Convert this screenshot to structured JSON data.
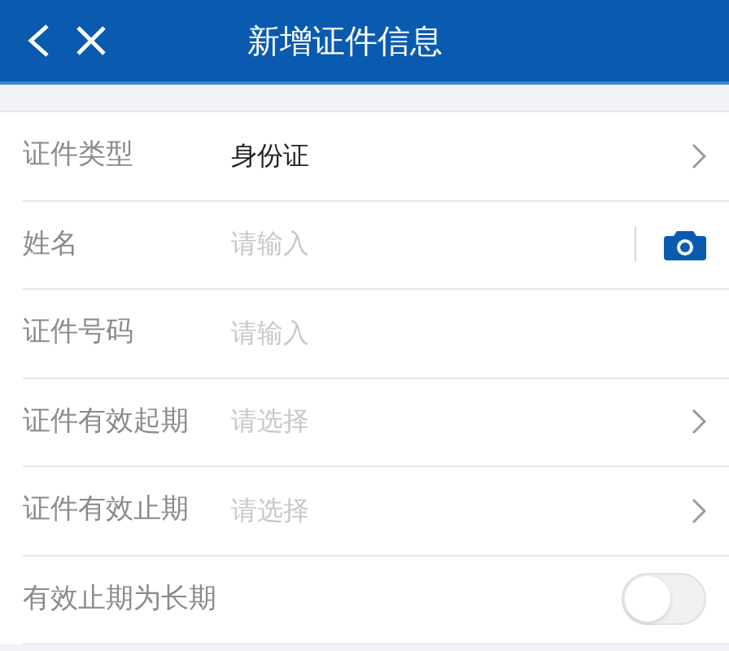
{
  "header": {
    "title": "新增证件信息"
  },
  "rows": [
    {
      "kind": "select",
      "label": "证件类型",
      "value": "身份证"
    },
    {
      "kind": "camera",
      "label": "姓名",
      "placeholder": "请输入"
    },
    {
      "kind": "input",
      "label": "证件号码",
      "placeholder": "请输入"
    },
    {
      "kind": "select",
      "label": "证件有效起期",
      "placeholder": "请选择"
    },
    {
      "kind": "select",
      "label": "证件有效止期",
      "placeholder": "请选择"
    },
    {
      "kind": "switch",
      "label": "有效止期为长期",
      "on": false
    }
  ]
}
